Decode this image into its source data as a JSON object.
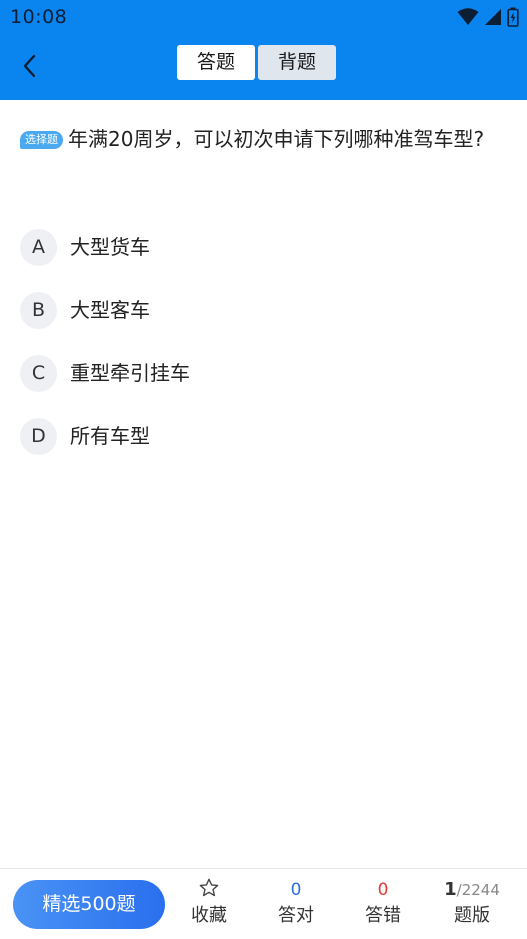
{
  "status_bar": {
    "time": "10:08",
    "icons": [
      "wifi-icon",
      "signal-icon",
      "battery-icon"
    ]
  },
  "toolbar": {
    "back_icon": "chevron-left-icon",
    "modes": [
      {
        "label": "答题",
        "active": true
      },
      {
        "label": "背题",
        "active": false
      }
    ]
  },
  "question": {
    "type_badge": "选择题",
    "text": "年满20周岁，可以初次申请下列哪种准驾车型?",
    "options": [
      {
        "letter": "A",
        "text": "大型货车"
      },
      {
        "letter": "B",
        "text": "大型客车"
      },
      {
        "letter": "C",
        "text": "重型牵引挂车"
      },
      {
        "letter": "D",
        "text": "所有车型"
      }
    ]
  },
  "bottom_bar": {
    "select_button": "精选500题",
    "favorite": {
      "icon": "star-icon",
      "label": "收藏"
    },
    "correct": {
      "count": "0",
      "label": "答对"
    },
    "wrong": {
      "count": "0",
      "label": "答错"
    },
    "progress": {
      "current": "1",
      "separator": "/",
      "total": "2244",
      "label": "题版"
    }
  },
  "colors": {
    "header": "#0a84ee",
    "badge": "#4aa9f0",
    "correct": "#2f6fe6",
    "wrong": "#e53935"
  }
}
